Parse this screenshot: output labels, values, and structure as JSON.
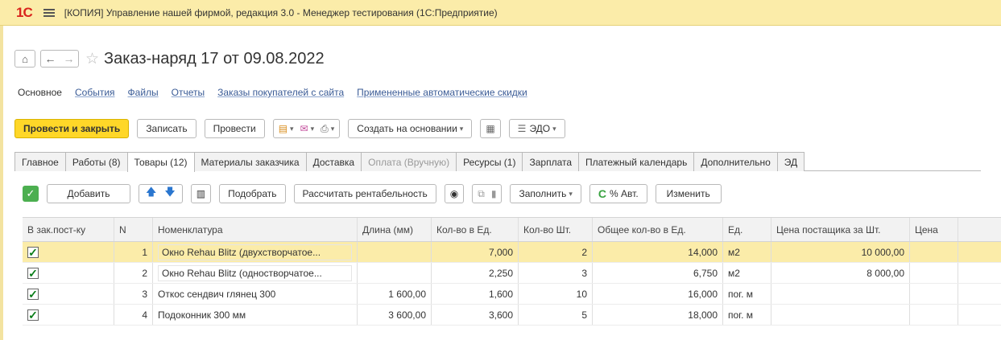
{
  "app": {
    "logo": "1С",
    "title": "[КОПИЯ] Управление нашей фирмой, редакция 3.0  - Менеджер тестирования (1С:Предприятие)"
  },
  "header": {
    "document_title": "Заказ-наряд 17 от 09.08.2022"
  },
  "links": {
    "active": "Основное",
    "items": [
      "События",
      "Файлы",
      "Отчеты",
      "Заказы покупателей с сайта",
      "Примененные автоматические скидки"
    ]
  },
  "commands": {
    "post_close": "Провести и закрыть",
    "save": "Записать",
    "post": "Провести",
    "create_based": "Создать на основании",
    "edo": "ЭДО"
  },
  "tabs": [
    {
      "label": "Главное"
    },
    {
      "label": "Работы (8)"
    },
    {
      "label": "Товары (12)",
      "active": true
    },
    {
      "label": "Материалы заказчика"
    },
    {
      "label": "Доставка"
    },
    {
      "label": "Оплата (Вручную)",
      "disabled": true
    },
    {
      "label": "Ресурсы (1)"
    },
    {
      "label": "Зарплата"
    },
    {
      "label": "Платежный календарь"
    },
    {
      "label": "Дополнительно"
    },
    {
      "label": "ЭД"
    }
  ],
  "grid_toolbar": {
    "add": "Добавить",
    "pick": "Подобрать",
    "calc_profit": "Рассчитать рентабельность",
    "fill": "Заполнить",
    "auto_percent": "% Авт.",
    "change": "Изменить"
  },
  "table": {
    "columns": [
      "В зак.пост-ку",
      "N",
      "Номенклатура",
      "Длина (мм)",
      "Кол-во в Ед.",
      "Кол-во Шт.",
      "Общее кол-во в Ед.",
      "Ед.",
      "Цена постащика за Шт.",
      "Цена"
    ],
    "rows": [
      {
        "checked": true,
        "n": "1",
        "name": "Окно Rehau Blitz (двухстворчатое...",
        "length": "",
        "qty_unit": "7,000",
        "qty_pcs": "2",
        "total": "14,000",
        "unit": "м2",
        "price": "10 000,00"
      },
      {
        "checked": true,
        "n": "2",
        "name": "Окно Rehau Blitz (одностворчатое...",
        "length": "",
        "qty_unit": "2,250",
        "qty_pcs": "3",
        "total": "6,750",
        "unit": "м2",
        "price": "8 000,00"
      },
      {
        "checked": true,
        "n": "3",
        "name": "Откос сендвич глянец 300",
        "length": "1 600,00",
        "qty_unit": "1,600",
        "qty_pcs": "10",
        "total": "16,000",
        "unit": "пог. м",
        "price": ""
      },
      {
        "checked": true,
        "n": "4",
        "name": "Подоконник 300 мм",
        "length": "3 600,00",
        "qty_unit": "3,600",
        "qty_pcs": "5",
        "total": "18,000",
        "unit": "пог. м",
        "price": ""
      }
    ]
  },
  "colors": {
    "titlebar": "#fbeca9",
    "primary_button": "#ffd728",
    "link": "#3a5b96",
    "selected_row": "#fbeca9"
  }
}
